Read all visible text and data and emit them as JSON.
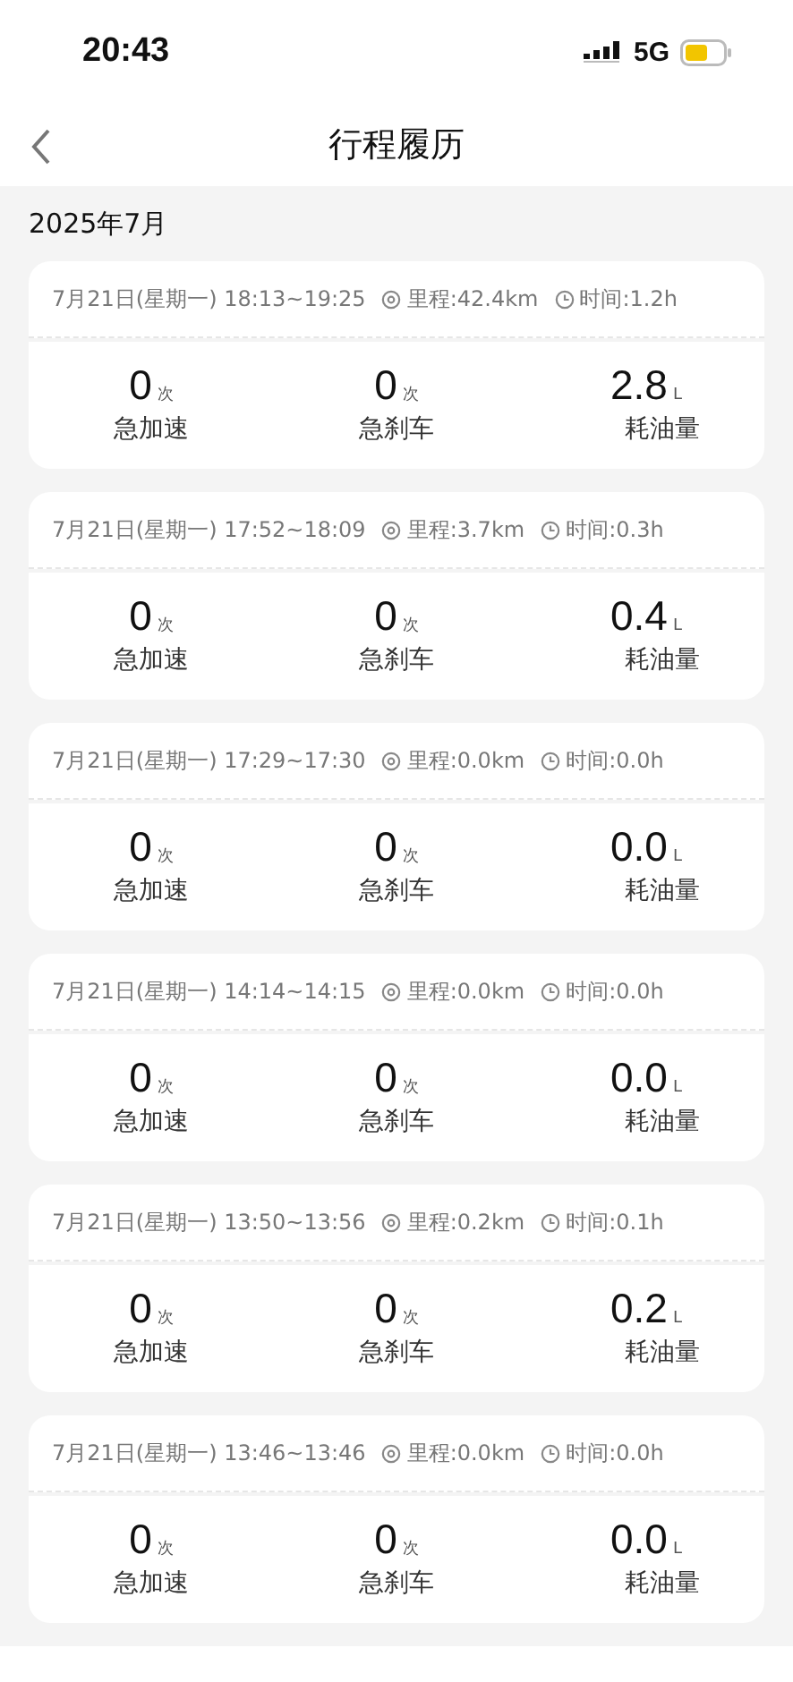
{
  "status_bar": {
    "time": "20:43",
    "network": "5G"
  },
  "nav": {
    "title": "行程履历"
  },
  "month": "2025年7月",
  "trips": [
    {
      "date": "7月21日(星期一) 18:13~19:25",
      "distance": "里程:42.4km",
      "duration": "时间:1.2h",
      "stats": [
        {
          "value": "0",
          "unit": "次",
          "label": "急加速"
        },
        {
          "value": "0",
          "unit": "次",
          "label": "急刹车"
        },
        {
          "value": "2.8",
          "unit": "L",
          "label": "耗油量"
        }
      ]
    },
    {
      "date": "7月21日(星期一) 17:52~18:09",
      "distance": "里程:3.7km",
      "duration": "时间:0.3h",
      "stats": [
        {
          "value": "0",
          "unit": "次",
          "label": "急加速"
        },
        {
          "value": "0",
          "unit": "次",
          "label": "急刹车"
        },
        {
          "value": "0.4",
          "unit": "L",
          "label": "耗油量"
        }
      ]
    },
    {
      "date": "7月21日(星期一) 17:29~17:30",
      "distance": "里程:0.0km",
      "duration": "时间:0.0h",
      "stats": [
        {
          "value": "0",
          "unit": "次",
          "label": "急加速"
        },
        {
          "value": "0",
          "unit": "次",
          "label": "急刹车"
        },
        {
          "value": "0.0",
          "unit": "L",
          "label": "耗油量"
        }
      ]
    },
    {
      "date": "7月21日(星期一) 14:14~14:15",
      "distance": "里程:0.0km",
      "duration": "时间:0.0h",
      "stats": [
        {
          "value": "0",
          "unit": "次",
          "label": "急加速"
        },
        {
          "value": "0",
          "unit": "次",
          "label": "急刹车"
        },
        {
          "value": "0.0",
          "unit": "L",
          "label": "耗油量"
        }
      ]
    },
    {
      "date": "7月21日(星期一) 13:50~13:56",
      "distance": "里程:0.2km",
      "duration": "时间:0.1h",
      "stats": [
        {
          "value": "0",
          "unit": "次",
          "label": "急加速"
        },
        {
          "value": "0",
          "unit": "次",
          "label": "急刹车"
        },
        {
          "value": "0.2",
          "unit": "L",
          "label": "耗油量"
        }
      ]
    },
    {
      "date": "7月21日(星期一) 13:46~13:46",
      "distance": "里程:0.0km",
      "duration": "时间:0.0h",
      "stats": [
        {
          "value": "0",
          "unit": "次",
          "label": "急加速"
        },
        {
          "value": "0",
          "unit": "次",
          "label": "急刹车"
        },
        {
          "value": "0.0",
          "unit": "L",
          "label": "耗油量"
        }
      ]
    }
  ]
}
